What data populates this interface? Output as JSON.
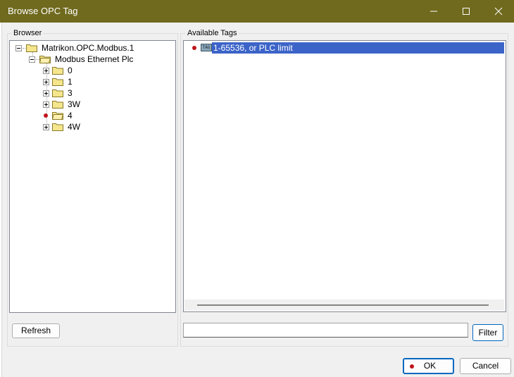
{
  "window": {
    "title": "Browse OPC Tag"
  },
  "browser": {
    "label": "Browser",
    "tree": {
      "root": "Matrikon.OPC.Modbus.1",
      "child": "Modbus Ethernet Plc",
      "items": [
        "0",
        "1",
        "3",
        "3W",
        "4",
        "4W"
      ]
    },
    "refresh_label": "Refresh"
  },
  "tags": {
    "label": "Available Tags",
    "items": [
      "1-65536, or PLC limit"
    ],
    "icon_text": "TAG"
  },
  "filter": {
    "value": "",
    "button_label": "Filter"
  },
  "footer": {
    "ok_label": "OK",
    "cancel_label": "Cancel"
  },
  "colors": {
    "titlebar": "#6f6a1e",
    "selection": "#3c64c8",
    "marker": "#c0141c"
  }
}
